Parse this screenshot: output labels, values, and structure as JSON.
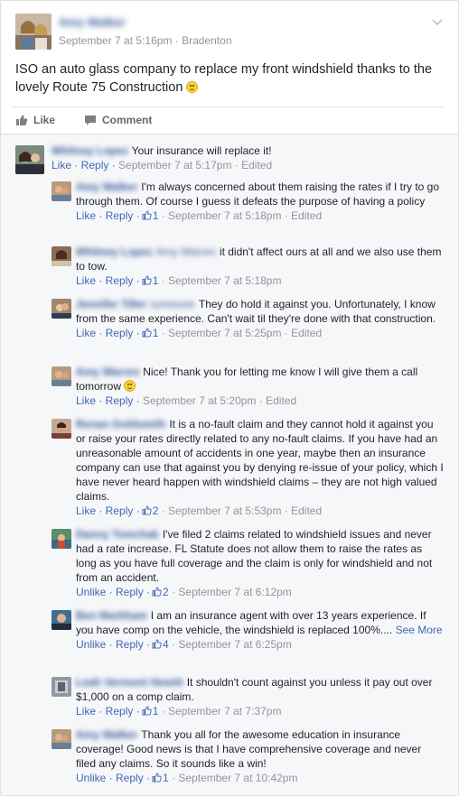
{
  "post": {
    "author": "Amy Walker",
    "date": "September 7 at 5:16pm",
    "separator": "·",
    "location": "Bradenton",
    "text": "ISO an auto glass company to replace my front windshield thanks to the lovely Route 75 Construction",
    "like_label": "Like",
    "comment_label": "Comment"
  },
  "comments": [
    {
      "name": "Whitney Lopez",
      "tag": "",
      "text": "Your insurance will replace it!",
      "actions": "Like · Reply ·",
      "count": "",
      "meta": "September 7 at 5:17pm · Edited",
      "see_more": ""
    },
    {
      "name": "Amy Walker",
      "tag": "",
      "text": "I'm always concerned about them raising the rates if I try to go through them. Of course I guess it defeats the purpose of having a policy",
      "actions": "Like · Reply ·",
      "count": "1",
      "meta": "· September 7 at 5:18pm · Edited",
      "see_more": ""
    },
    {
      "name": "Whitney Lopez",
      "tag": "Amy Warren",
      "text": "it didn't affect ours at all and we also use them to tow.",
      "actions": "Like · Reply ·",
      "count": "1",
      "meta": "· September 7 at 5:18pm",
      "see_more": ""
    },
    {
      "name": "Jennifer Tiller",
      "tag": "someone",
      "text": "They do hold it against you. Unfortunately, I know from the same experience. Can't wait til they're done with that construction.",
      "actions": "Like · Reply ·",
      "count": "1",
      "meta": "· September 7 at 5:25pm · Edited",
      "see_more": ""
    },
    {
      "name": "Amy Warren",
      "tag": "",
      "text": "Nice! Thank you for letting me know I will give them a call tomorrow",
      "actions": "Like · Reply ·",
      "count": "",
      "meta": "September 7 at 5:20pm · Edited",
      "see_more": ""
    },
    {
      "name": "Renan Goldsmith",
      "tag": "",
      "text": "It is a no-fault claim and they cannot hold it against you or raise your rates directly related to any no-fault claims. If you have had an unreasonable amount of accidents in one year, maybe then an insurance company can use that against you by denying re-issue of your policy, which I have never heard happen with windshield claims – they are not high valued claims.",
      "actions": "Like · Reply ·",
      "count": "2",
      "meta": "· September 7 at 5:53pm · Edited",
      "see_more": ""
    },
    {
      "name": "Danny Tomchak",
      "tag": "",
      "text": "I've filed 2 claims related to windshield issues and never had a rate increase. FL Statute does not allow them to raise the rates as long as you have full coverage and the claim is only for windshield and not from an accident.",
      "actions": "Unlike · Reply ·",
      "count": "2",
      "meta": "· September 7 at 6:12pm",
      "see_more": ""
    },
    {
      "name": "Ben Markham",
      "tag": "",
      "text": "I am an insurance agent with over 13 years experience. If you have comp on the vehicle, the windshield is replaced 100%....",
      "actions": "Unlike · Reply ·",
      "count": "4",
      "meta": "· September 7 at 6:25pm",
      "see_more": "See More"
    },
    {
      "name": "Leah Vermont Hewitt",
      "tag": "",
      "text": "It shouldn't count against you unless it pay out over $1,000 on a comp claim.",
      "actions": "Like · Reply ·",
      "count": "1",
      "meta": "· September 7 at 7:37pm",
      "see_more": ""
    },
    {
      "name": "Amy Walker",
      "tag": "",
      "text": "Thank you all for the awesome education in insurance coverage! Good news is that I have comprehensive coverage and never filed any claims. So it sounds like a win!",
      "actions": "Unlike · Reply ·",
      "count": "1",
      "meta": "· September 7 at 10:42pm",
      "see_more": ""
    }
  ]
}
